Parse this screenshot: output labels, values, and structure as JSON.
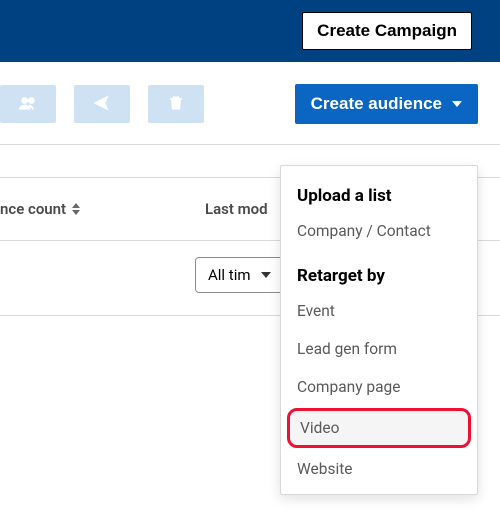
{
  "topbar": {
    "create_campaign_label": "Create Campaign"
  },
  "toolbar": {
    "group_label": "Group",
    "share_label": "Share",
    "delete_label": "Delete",
    "create_audience_label": "Create audience"
  },
  "table": {
    "columns": {
      "count": "nce count",
      "last_modified": "Last mod"
    },
    "filter": {
      "all_time": "All tim"
    }
  },
  "dropdown": {
    "section_upload": "Upload a list",
    "item_company_contact": "Company / Contact",
    "section_retarget": "Retarget by",
    "item_event": "Event",
    "item_lead_gen": "Lead gen form",
    "item_company_page": "Company page",
    "item_video": "Video",
    "item_website": "Website"
  }
}
